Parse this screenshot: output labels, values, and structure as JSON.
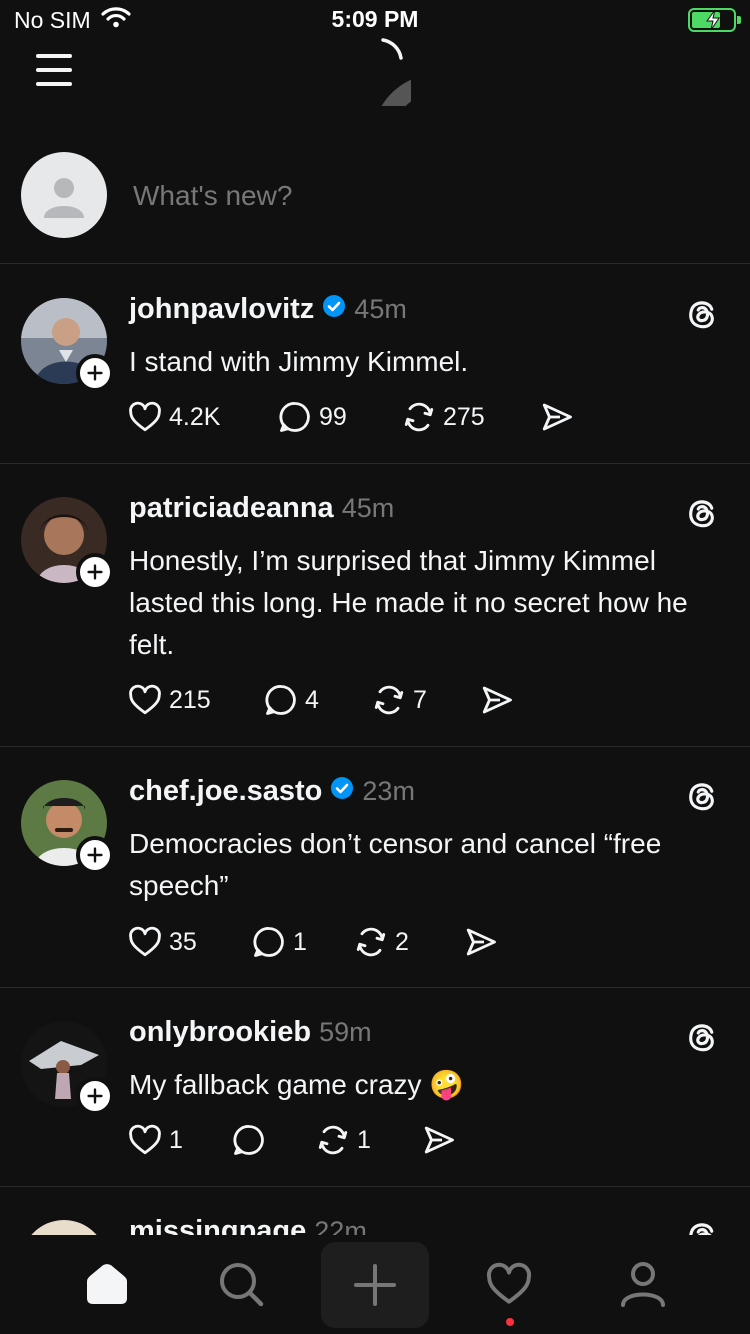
{
  "status": {
    "carrier": "No SIM",
    "time": "5:09 PM"
  },
  "composer": {
    "placeholder": "What's new?"
  },
  "posts": [
    {
      "username": "johnpavlovitz",
      "verified": true,
      "time": "45m",
      "text": "I stand with Jimmy Kimmel.",
      "likes": "4.2K",
      "replies": "99",
      "reposts": "275"
    },
    {
      "username": "patriciadeanna",
      "verified": false,
      "time": "45m",
      "text": "Honestly, I’m surprised that Jimmy Kimmel lasted this long. He made it no secret how he felt.",
      "likes": "215",
      "replies": "4",
      "reposts": "7"
    },
    {
      "username": "chef.joe.sasto",
      "verified": true,
      "time": "23m",
      "text": "Democracies don’t censor and cancel “free speech”",
      "likes": "35",
      "replies": "1",
      "reposts": "2"
    },
    {
      "username": "onlybrookieb",
      "verified": false,
      "time": "59m",
      "text": "My fallback game crazy 🤪",
      "likes": "1",
      "replies": "",
      "reposts": "1"
    },
    {
      "username": "missingpage",
      "verified": false,
      "time": "22m"
    }
  ],
  "icons": {
    "menu": "hamburger-menu-icon",
    "logo": "threads-logo-icon",
    "like": "heart-icon",
    "reply": "speech-bubble-icon",
    "repost": "repost-icon",
    "share": "send-icon",
    "home": "home-icon",
    "search": "search-icon",
    "create": "plus-icon",
    "activity": "heart-icon",
    "profile": "person-icon"
  },
  "colors": {
    "background": "#101010",
    "text": "#f3f5f7",
    "muted": "#777777",
    "verified": "#0095f6",
    "notification": "#ff3040",
    "battery": "#4cd964"
  }
}
